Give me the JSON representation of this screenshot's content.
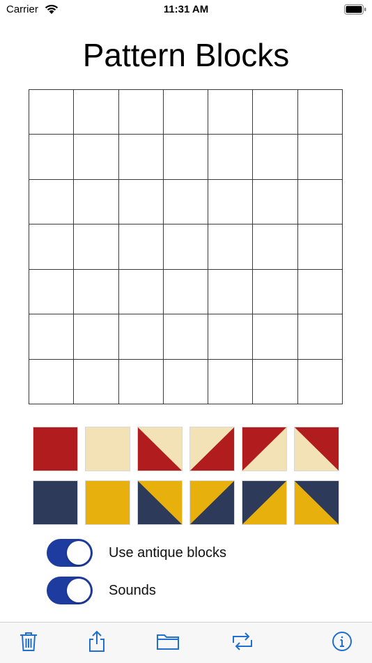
{
  "status_bar": {
    "carrier": "Carrier",
    "time": "11:31 AM",
    "battery_level": 1.0
  },
  "title": "Pattern Blocks",
  "grid": {
    "rows": 7,
    "columns": 7
  },
  "palette": {
    "row1": [
      {
        "name": "red-solid-block",
        "type": "solid",
        "fill": "#b11c1f"
      },
      {
        "name": "cream-solid-block",
        "type": "solid",
        "fill": "#f3e2b6"
      },
      {
        "name": "red-cream-diagonal-block-1",
        "type": "diag",
        "orientation": "bl-red"
      },
      {
        "name": "cream-red-diagonal-block-2",
        "type": "diag",
        "orientation": "br-red"
      },
      {
        "name": "red-cream-diagonal-block-3",
        "type": "diag",
        "orientation": "tl-red"
      },
      {
        "name": "cream-red-diagonal-block-4",
        "type": "diag",
        "orientation": "tr-red"
      }
    ],
    "row2": [
      {
        "name": "navy-solid-block",
        "type": "solid",
        "fill": "#2d3a5a"
      },
      {
        "name": "yellow-solid-block",
        "type": "solid",
        "fill": "#e7b00c"
      },
      {
        "name": "navy-yellow-diagonal-block-1",
        "type": "diag",
        "orientation": "bl-navy"
      },
      {
        "name": "yellow-navy-diagonal-block-2",
        "type": "diag",
        "orientation": "br-navy"
      },
      {
        "name": "navy-yellow-diagonal-block-3",
        "type": "diag",
        "orientation": "tl-navy"
      },
      {
        "name": "yellow-navy-diagonal-block-4",
        "type": "diag",
        "orientation": "tr-navy"
      }
    ]
  },
  "colors": {
    "red": "#b11c1f",
    "cream": "#f3e2b6",
    "navy": "#2d3a5a",
    "yellow": "#e7b00c",
    "accent": "#1e6fd0",
    "toggle_on": "#1e3ca0"
  },
  "settings": {
    "antique_label": "Use antique blocks",
    "antique_on": true,
    "sounds_label": "Sounds",
    "sounds_on": true
  },
  "toolbar": {
    "icons": [
      "trash-icon",
      "share-icon",
      "folder-icon",
      "repeat-icon",
      "info-icon"
    ]
  }
}
